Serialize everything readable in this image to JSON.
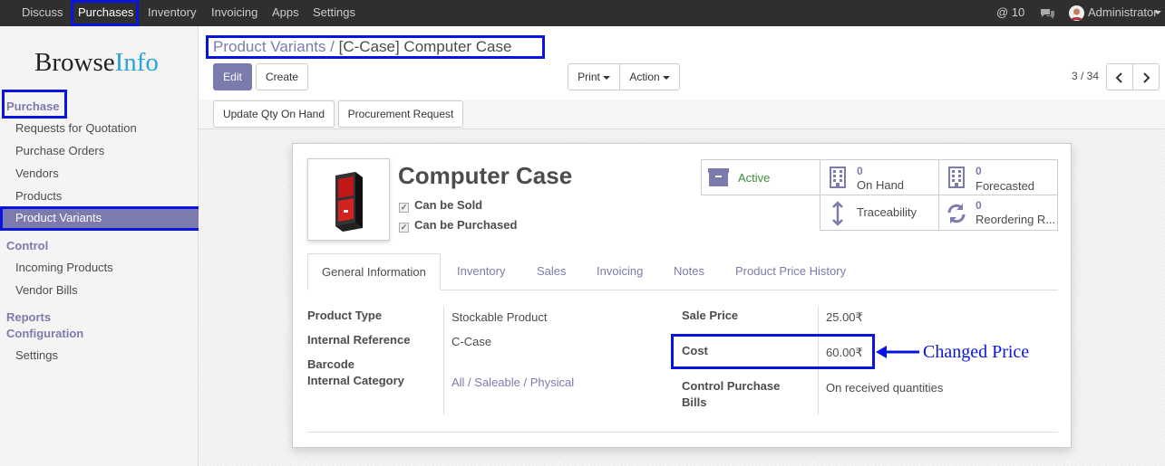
{
  "topbar": {
    "menu": [
      "Discuss",
      "Purchases",
      "Inventory",
      "Invoicing",
      "Apps",
      "Settings"
    ],
    "mentions": "@ 10",
    "user": "Administrator"
  },
  "sidebar": {
    "logo_a": "Browse",
    "logo_b": "Info",
    "section_purchase": "Purchase",
    "purchase_items": [
      "Requests for Quotation",
      "Purchase Orders",
      "Vendors",
      "Products",
      "Product Variants"
    ],
    "section_control": "Control",
    "control_items": [
      "Incoming Products",
      "Vendor Bills"
    ],
    "section_reports": "Reports",
    "section_configuration": "Configuration",
    "config_items": [
      "Settings"
    ]
  },
  "control_panel": {
    "breadcrumb_parent": "Product Variants",
    "breadcrumb_sep": "/",
    "breadcrumb_current": "[C-Case] Computer Case",
    "edit": "Edit",
    "create": "Create",
    "print": "Print",
    "action": "Action",
    "pager": "3 / 34"
  },
  "statusbar": {
    "update_qty": "Update Qty On Hand",
    "procurement": "Procurement Request"
  },
  "product": {
    "name": "Computer Case",
    "can_be_sold": "Can be Sold",
    "can_be_purchased": "Can be Purchased"
  },
  "smart_buttons": {
    "active": "Active",
    "on_hand_num": "0",
    "on_hand": "On Hand",
    "forecasted_num": "0",
    "forecasted": "Forecasted",
    "traceability": "Traceability",
    "reordering_num": "0",
    "reordering": "Reordering R..."
  },
  "tabs": [
    "General Information",
    "Inventory",
    "Sales",
    "Invoicing",
    "Notes",
    "Product Price History"
  ],
  "fields": {
    "product_type_label": "Product Type",
    "product_type": "Stockable Product",
    "internal_ref_label": "Internal Reference",
    "internal_ref": "C-Case",
    "barcode_label": "Barcode",
    "internal_cat_label": "Internal Category",
    "internal_cat": "All / Saleable / Physical",
    "sale_price_label": "Sale Price",
    "sale_price": "25.00₹",
    "cost_label": "Cost",
    "cost": "60.00₹",
    "control_purchase_label_1": "Control Purchase",
    "control_purchase_label_2": "Bills",
    "control_purchase": "On received quantities"
  },
  "annotation": "Changed Price",
  "colors": {
    "accent": "#7c7bad",
    "highlight": "#0a14e0",
    "topbar": "#2f2f2f"
  }
}
